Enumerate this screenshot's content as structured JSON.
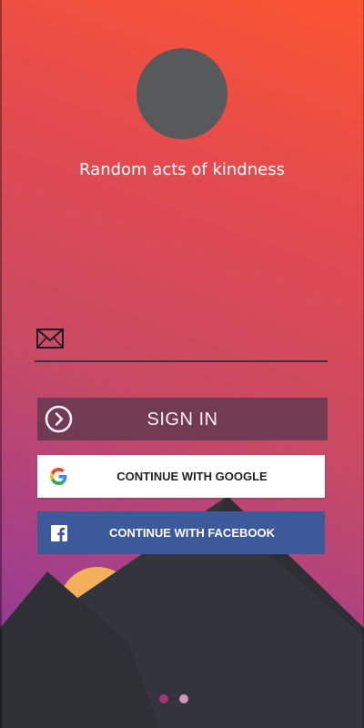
{
  "app": {
    "tagline": "Random acts of kindness"
  },
  "email": {
    "icon": "mail-icon",
    "value": "",
    "placeholder": ""
  },
  "buttons": {
    "signin_label": "SIGN IN",
    "google_label": "CONTINUE WITH GOOGLE",
    "facebook_label": "CONTINUE WITH FACEBOOK"
  },
  "pager": {
    "count": 2,
    "active_index": 0
  },
  "colors": {
    "gradient_top": "#fb5530",
    "gradient_bottom": "#7a3a9c",
    "avatar": "#58595b",
    "signin_bg": "#6b3a52",
    "facebook_blue": "#3c5a99",
    "mountain": "#34353c",
    "sun": "#f2b05a"
  }
}
